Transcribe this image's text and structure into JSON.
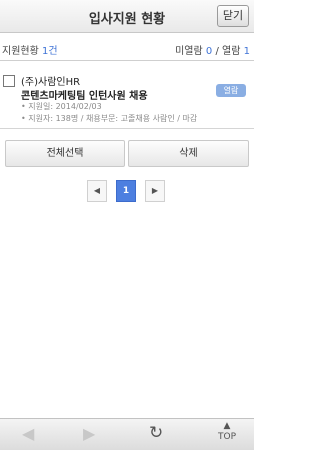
{
  "header": {
    "title": "입사지원 현황",
    "close_label": "닫기"
  },
  "summary": {
    "label": "지원현황",
    "count": "1건",
    "unread_label": "미열람",
    "unread_count": "0",
    "separator": "/",
    "read_label": "열람",
    "read_count": "1"
  },
  "application": {
    "company": "(주)사람인HR",
    "job_title": "콘텐츠마케팅팀 인턴사원 채용",
    "applied_date": "• 지원일: 2014/02/03",
    "details": "• 지원자: 138명 / 채용부문: 고졸채용 사람인 / 마감",
    "status": "열람"
  },
  "actions": {
    "select_all": "전체선택",
    "delete": "삭제"
  },
  "pagination": {
    "prev": "◀",
    "current_page": "1",
    "next": "▶"
  },
  "bottom_bar": {
    "back_icon": "◀",
    "forward_icon": "▶",
    "refresh_icon": "↻",
    "top_arrow": "▲",
    "top_label": "TOP"
  },
  "colors": {
    "accent": "#3f73d6",
    "badge": "#8aaee3",
    "active_page": "#4d7fe0"
  }
}
